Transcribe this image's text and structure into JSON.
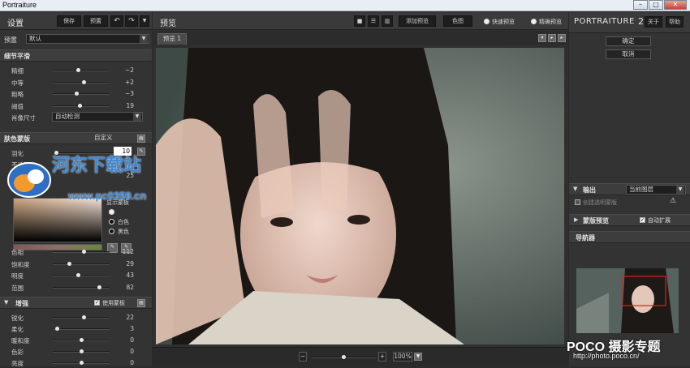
{
  "window": {
    "title": "Portraiture"
  },
  "left": {
    "header": {
      "title": "设置",
      "save": "保存",
      "preset": "预置",
      "undo": "↶",
      "redo": "↷"
    },
    "preset": {
      "label": "预置",
      "value": "默认"
    },
    "detail": {
      "title": "细节平滑",
      "sliders": [
        {
          "label": "精细",
          "value": "−2",
          "pos": 0.45
        },
        {
          "label": "中等",
          "value": "+2",
          "pos": 0.55
        },
        {
          "label": "粗略",
          "value": "−3",
          "pos": 0.42
        },
        {
          "label": "阈值",
          "value": "19",
          "pos": 0.48
        }
      ],
      "portrait_size_label": "肖像尺寸",
      "portrait_size_value": "自动检测"
    },
    "skin": {
      "title": "肤色蒙版",
      "mode": "自定义",
      "feather_label": "羽化",
      "feather_value": "10",
      "blur_labels": [
        "不透明度",
        "色相"
      ],
      "blur_value": "25",
      "show_mask_label": "显示蒙板",
      "radio_white": "白色",
      "radio_black": "黑色",
      "sliders": [
        {
          "label": "色相",
          "value": "112",
          "pos": 0.55
        },
        {
          "label": "饱和度",
          "value": "29",
          "pos": 0.28
        },
        {
          "label": "明度",
          "value": "43",
          "pos": 0.45
        },
        {
          "label": "范围",
          "value": "82",
          "pos": 0.85
        }
      ]
    },
    "enhance": {
      "title": "增强",
      "use_mask": "使用蒙板",
      "sliders": [
        {
          "label": "锐化",
          "value": "22",
          "pos": 0.55
        },
        {
          "label": "柔化",
          "value": "3",
          "pos": 0.05
        },
        {
          "label": "暖和度",
          "value": "0",
          "pos": 0.5
        },
        {
          "label": "色彩",
          "value": "0",
          "pos": 0.5
        },
        {
          "label": "亮度",
          "value": "0",
          "pos": 0.5
        }
      ]
    }
  },
  "center": {
    "title": "预览",
    "add_preview": "添加预览",
    "compare": "色图",
    "fast_preview": "快速预览",
    "accurate_preview": "精确预览",
    "tab": "预览 1",
    "zoom_minus": "−",
    "zoom_plus": "+",
    "zoom_value": "100%"
  },
  "right": {
    "brand": "PORTRAITURE",
    "version": "2",
    "about": "关于",
    "help": "帮助",
    "ok": "确定",
    "cancel": "取消",
    "output": {
      "title": "输出",
      "target": "当前图层",
      "create_label": "创建透明蒙版"
    },
    "mask_preview": {
      "title": "蒙版预览",
      "auto_expand": "自动扩展"
    },
    "navigator": {
      "title": "导航器"
    }
  },
  "watermark": {
    "site_name": "河东下载站",
    "site_url": "www.pc0359.cn",
    "poco_brand": "POCO 摄影专题",
    "poco_url": "http://photo.poco.cn/"
  }
}
